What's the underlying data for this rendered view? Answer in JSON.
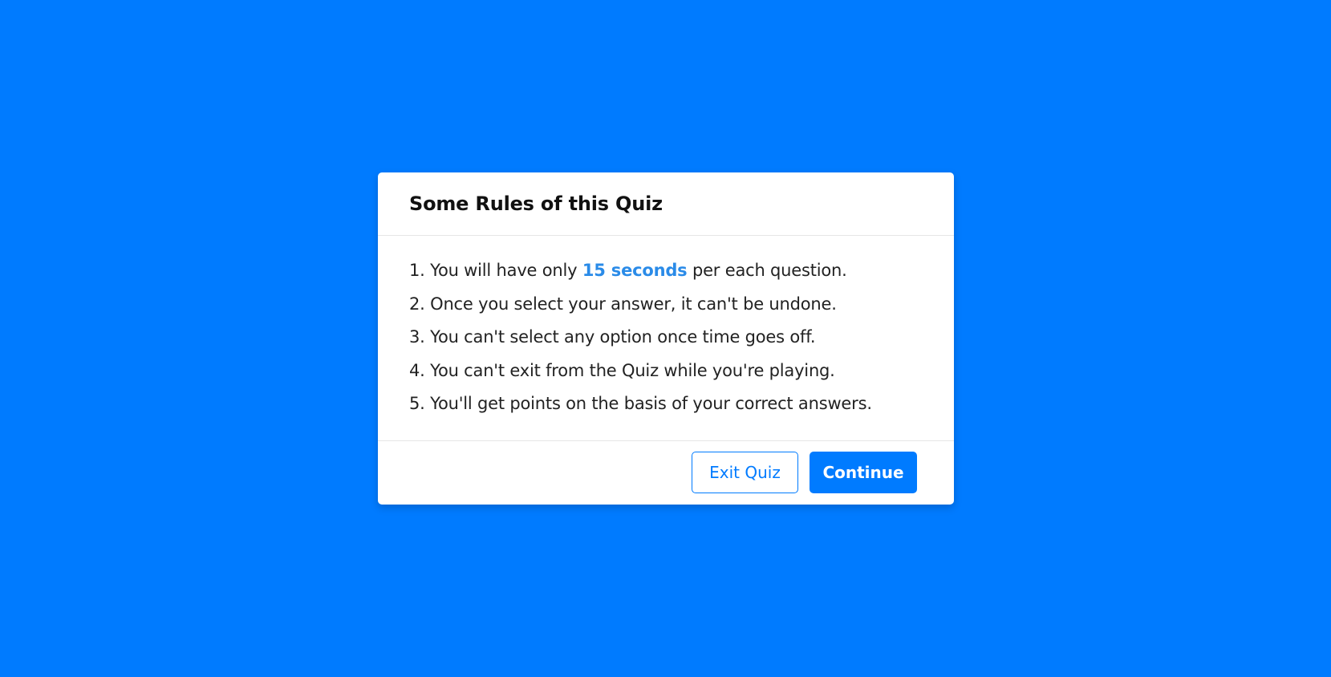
{
  "colors": {
    "background": "#007bff",
    "accent": "#007bff",
    "highlight": "#2a8be8"
  },
  "dialog": {
    "title": "Some Rules of this Quiz",
    "rules": [
      {
        "prefix": "1. You will have only ",
        "highlight": "15 seconds",
        "suffix": " per each question."
      },
      {
        "text": "2. Once you select your answer, it can't be undone."
      },
      {
        "text": "3. You can't select any option once time goes off."
      },
      {
        "text": "4. You can't exit from the Quiz while you're playing."
      },
      {
        "text": "5. You'll get points on the basis of your correct answers."
      }
    ],
    "buttons": {
      "exit_label": "Exit Quiz",
      "continue_label": "Continue"
    }
  }
}
